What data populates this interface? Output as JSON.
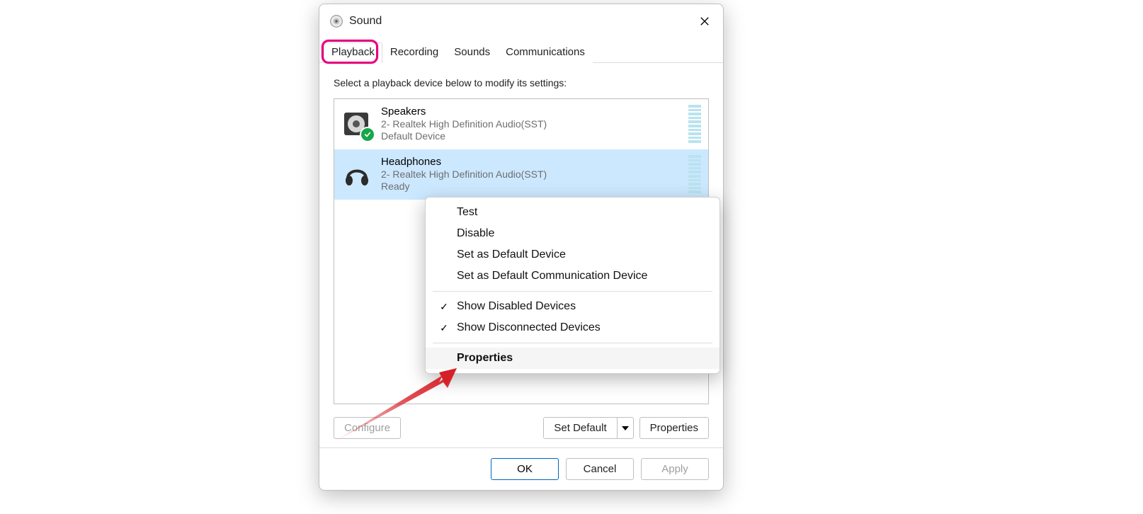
{
  "window": {
    "title": "Sound"
  },
  "tabs": {
    "items": [
      "Playback",
      "Recording",
      "Sounds",
      "Communications"
    ],
    "active": "Playback"
  },
  "instruction": "Select a playback device below to modify its settings:",
  "devices": [
    {
      "name": "Speakers",
      "sub": "2- Realtek High Definition Audio(SST)",
      "status": "Default Device",
      "default": true,
      "selected": false,
      "icon": "speaker-icon"
    },
    {
      "name": "Headphones",
      "sub": "2- Realtek High Definition Audio(SST)",
      "status": "Ready",
      "default": false,
      "selected": true,
      "icon": "headphones-icon"
    }
  ],
  "context_menu": {
    "items": [
      {
        "label": "Test",
        "checked": false
      },
      {
        "label": "Disable",
        "checked": false
      },
      {
        "label": "Set as Default Device",
        "checked": false
      },
      {
        "label": "Set as Default Communication Device",
        "checked": false
      }
    ],
    "toggle_items": [
      {
        "label": "Show Disabled Devices",
        "checked": true
      },
      {
        "label": "Show Disconnected Devices",
        "checked": true
      }
    ],
    "highlight_item": {
      "label": "Properties"
    }
  },
  "buttons": {
    "configure": "Configure",
    "set_default": "Set Default",
    "properties": "Properties",
    "ok": "OK",
    "cancel": "Cancel",
    "apply": "Apply"
  },
  "colors": {
    "selection": "#cce8ff",
    "highlight_pink": "#e6007e",
    "arrow_red": "#d62027"
  }
}
